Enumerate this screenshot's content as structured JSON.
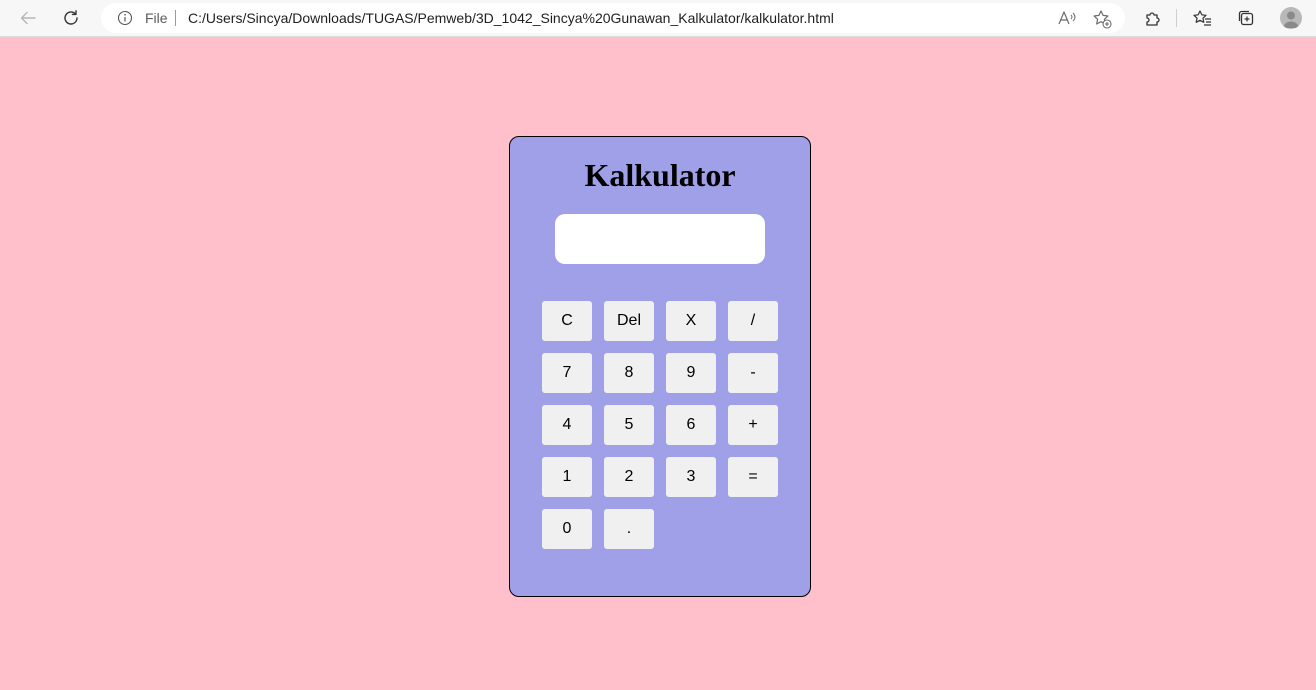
{
  "browser": {
    "file_label": "File",
    "url": "C:/Users/Sincya/Downloads/TUGAS/Pemweb/3D_1042_Sincya%20Gunawan_Kalkulator/kalkulator.html"
  },
  "calculator": {
    "title": "Kalkulator",
    "display_value": "",
    "keys": [
      {
        "label": "C",
        "name": "clear-button"
      },
      {
        "label": "Del",
        "name": "delete-button"
      },
      {
        "label": "X",
        "name": "multiply-button"
      },
      {
        "label": "/",
        "name": "divide-button"
      },
      {
        "label": "7",
        "name": "digit-7-button"
      },
      {
        "label": "8",
        "name": "digit-8-button"
      },
      {
        "label": "9",
        "name": "digit-9-button"
      },
      {
        "label": "-",
        "name": "subtract-button"
      },
      {
        "label": "4",
        "name": "digit-4-button"
      },
      {
        "label": "5",
        "name": "digit-5-button"
      },
      {
        "label": "6",
        "name": "digit-6-button"
      },
      {
        "label": "+",
        "name": "add-button"
      },
      {
        "label": "1",
        "name": "digit-1-button"
      },
      {
        "label": "2",
        "name": "digit-2-button"
      },
      {
        "label": "3",
        "name": "digit-3-button"
      },
      {
        "label": "=",
        "name": "equals-button"
      },
      {
        "label": "0",
        "name": "digit-0-button"
      },
      {
        "label": ".",
        "name": "decimal-point-button"
      }
    ]
  },
  "colors": {
    "page_background": "#ffc0cb",
    "calculator_background": "#a0a0e9",
    "key_background": "#f0f0f0"
  }
}
